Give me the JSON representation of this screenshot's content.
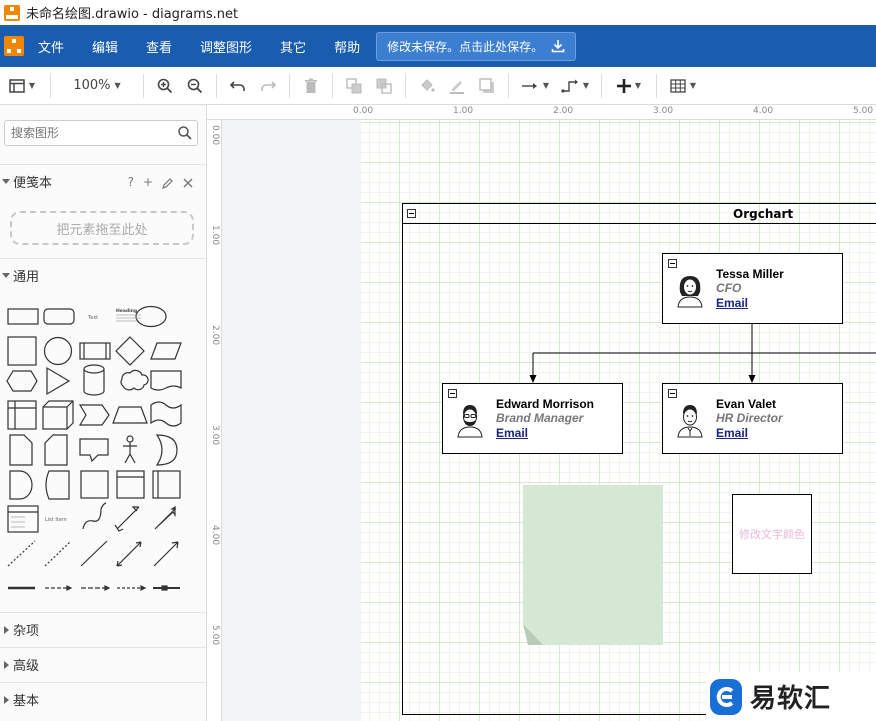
{
  "window": {
    "title": "未命名绘图.drawio - diagrams.net"
  },
  "menubar": {
    "items": [
      "文件",
      "编辑",
      "查看",
      "调整图形",
      "其它",
      "帮助"
    ],
    "save_notice": "修改未保存。点击此处保存。"
  },
  "toolbar": {
    "zoom": "100%"
  },
  "sidebar": {
    "search_placeholder": "搜索图形",
    "scratchpad": {
      "title": "便笺本",
      "help": "?",
      "drop_hint": "把元素拖至此处"
    },
    "general": {
      "title": "通用"
    },
    "shape_labels": {
      "text": "Text",
      "heading": "Heading",
      "list": "List Item"
    },
    "collapsed_sections": [
      "杂项",
      "高级",
      "基本"
    ]
  },
  "rulers": {
    "top": [
      "0.00",
      "1.00",
      "2.00",
      "3.00",
      "4.00",
      "5.00"
    ],
    "left": [
      "0.00",
      "1.00",
      "2.00",
      "3.00",
      "4.00",
      "5.00"
    ]
  },
  "diagram": {
    "orgchart_title": "Orgchart",
    "cards": [
      {
        "name": "Tessa Miller",
        "role": "CFO",
        "link": "Email"
      },
      {
        "name": "Edward Morrison",
        "role": "Brand Manager",
        "link": "Email"
      },
      {
        "name": "Evan Valet",
        "role": "HR Director",
        "link": "Email"
      }
    ],
    "textbox_label": "修改文字颜色",
    "note_color": "#d5e8d4"
  },
  "watermark": {
    "text": "易软汇"
  },
  "colors": {
    "menubar": "#1a5cad",
    "accent": "#f08705"
  }
}
